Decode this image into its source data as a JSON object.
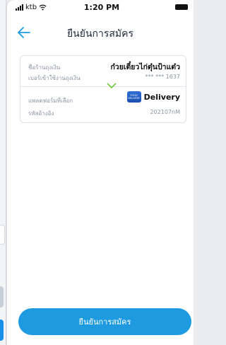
{
  "status_bar": {
    "carrier": "ktb",
    "time": "1:20 PM"
  },
  "header": {
    "title": "ยืนยันการสมัคร"
  },
  "details": {
    "shop_name_label": "ชื่อร้านถุงเงิน",
    "shop_name_value": "ก๋วยเตี๋ยวไก่ตุ๋นป้าแต๋ว",
    "phone_label": "เบอร์เข้าใช้งานถุงเงิน",
    "phone_value": "*** *** 1637",
    "platform_label": "แพลตฟอร์มที่เลือก",
    "platform_value": "Delivery",
    "platform_logo_text": "FOOD DELIVERY",
    "reference_label": "รหัสอ้างอิง",
    "reference_value": "202107nM"
  },
  "actions": {
    "confirm_label": "ยืนยันการสมัคร"
  },
  "colors": {
    "accent": "#1e9be0",
    "chevron": "#7ac943"
  }
}
